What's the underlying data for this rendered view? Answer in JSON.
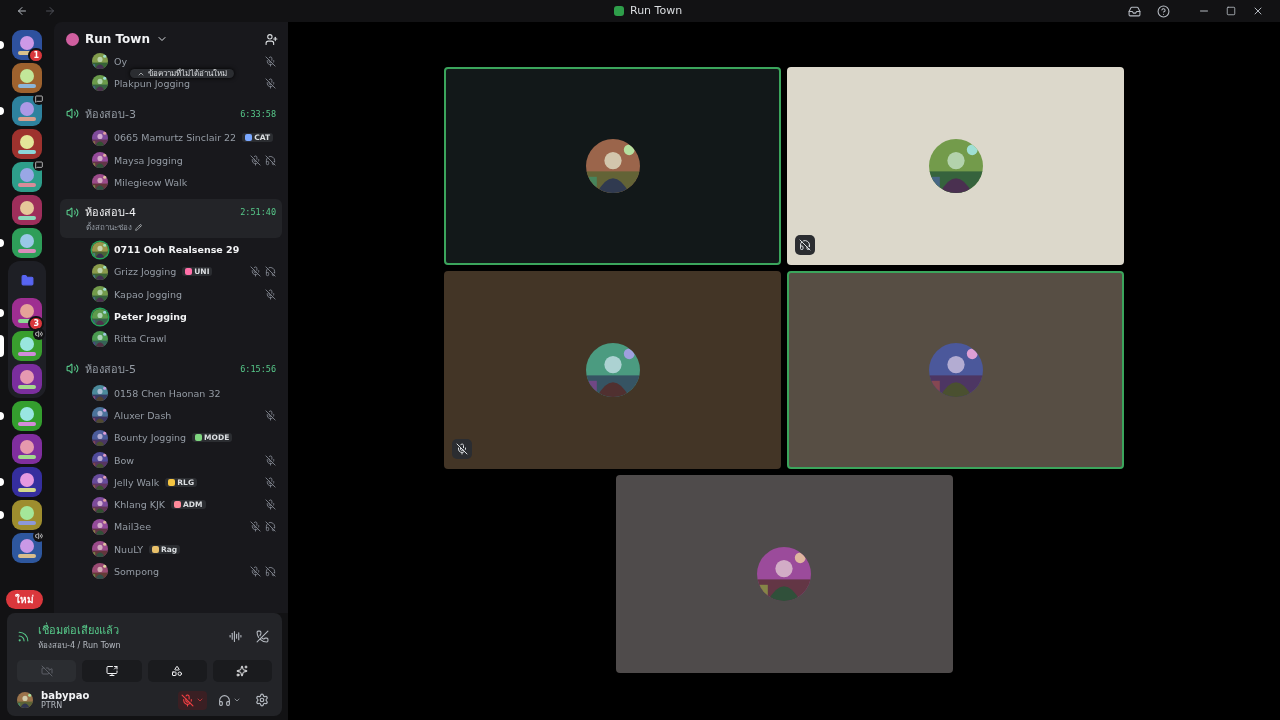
{
  "titlebar": {
    "title": "Run Town"
  },
  "servers": [
    {
      "kind": "server",
      "badge": "1",
      "unread": true,
      "selected": false,
      "chat_badge": false,
      "voice_badge": false
    },
    {
      "kind": "server",
      "unread": false,
      "selected": false,
      "chat_badge": false,
      "voice_badge": false
    },
    {
      "kind": "server",
      "unread": true,
      "selected": false,
      "chat_badge": true,
      "voice_badge": false
    },
    {
      "kind": "server",
      "unread": false,
      "selected": false,
      "chat_badge": false,
      "voice_badge": false
    },
    {
      "kind": "server",
      "unread": false,
      "selected": false,
      "chat_badge": true,
      "voice_badge": false
    },
    {
      "kind": "server",
      "unread": false,
      "selected": false,
      "chat_badge": false,
      "voice_badge": false
    },
    {
      "kind": "server",
      "unread": true,
      "selected": false,
      "chat_badge": false,
      "voice_badge": false
    },
    {
      "kind": "folder",
      "children": [
        {
          "kind": "server",
          "badge": "3",
          "unread": true,
          "selected": false,
          "chat_badge": false,
          "voice_badge": false
        },
        {
          "kind": "server",
          "unread": false,
          "selected": true,
          "chat_badge": false,
          "voice_badge": true
        },
        {
          "kind": "server",
          "unread": false,
          "selected": false,
          "chat_badge": false,
          "voice_badge": false
        }
      ]
    },
    {
      "kind": "server",
      "unread": true,
      "selected": false,
      "chat_badge": false,
      "voice_badge": false
    },
    {
      "kind": "server",
      "unread": false,
      "selected": false,
      "chat_badge": false,
      "voice_badge": false
    },
    {
      "kind": "server",
      "unread": true,
      "selected": false,
      "chat_badge": false,
      "voice_badge": false
    },
    {
      "kind": "server",
      "unread": true,
      "selected": false,
      "chat_badge": false,
      "voice_badge": false
    },
    {
      "kind": "server",
      "unread": false,
      "selected": false,
      "chat_badge": false,
      "voice_badge": true
    }
  ],
  "new_pill": "ใหม่",
  "sidebar": {
    "server_name": "Run Town",
    "unread_tooltip": "ข้อความที่ไม่ได้อ่านใหม่",
    "top_users": [
      {
        "name": "Oy",
        "speaking": false,
        "muted": true,
        "deafened": false
      },
      {
        "name": "Plakpun Jogging",
        "speaking": false,
        "muted": true,
        "deafened": false
      }
    ],
    "channels": [
      {
        "name": "ห้องสอบ-3",
        "timer": "6:33:58",
        "selected": false,
        "users": [
          {
            "name": "0665 Mamurtz Sinclair 22",
            "tag": {
              "label": "CAT",
              "color": "#7aa7ff"
            },
            "speaking": false,
            "muted": false,
            "deafened": false
          },
          {
            "name": "Maysa Jogging",
            "speaking": false,
            "muted": true,
            "deafened": true
          },
          {
            "name": "Milegieow Walk",
            "speaking": false,
            "muted": false,
            "deafened": false
          }
        ]
      },
      {
        "name": "ห้องสอบ-4",
        "timer": "2:51:40",
        "status": "ตั้งสถานะช่อง",
        "selected": true,
        "users": [
          {
            "name": "0711 Ooh Realsense 29",
            "speaking": true,
            "muted": false,
            "deafened": false
          },
          {
            "name": "Grizz Jogging",
            "tag": {
              "label": "UNI",
              "color": "#ff6fa8"
            },
            "speaking": false,
            "muted": true,
            "deafened": true
          },
          {
            "name": "Kapao Jogging",
            "speaking": false,
            "muted": true,
            "deafened": false
          },
          {
            "name": "Peter Jogging",
            "speaking": true,
            "muted": false,
            "deafened": false
          },
          {
            "name": "Ritta Crawl",
            "speaking": false,
            "muted": false,
            "deafened": false
          }
        ]
      },
      {
        "name": "ห้องสอบ-5",
        "timer": "6:15:56",
        "selected": false,
        "users": [
          {
            "name": "0158 Chen Haonan 32",
            "speaking": false,
            "muted": false,
            "deafened": false
          },
          {
            "name": "Aluxer Dash",
            "speaking": false,
            "muted": true,
            "deafened": false
          },
          {
            "name": "Bounty Jogging",
            "tag": {
              "label": "MODE",
              "color": "#7fd67f"
            },
            "speaking": false,
            "muted": false,
            "deafened": false
          },
          {
            "name": "Bow",
            "speaking": false,
            "muted": true,
            "deafened": false
          },
          {
            "name": "Jelly Walk",
            "tag": {
              "label": "RLG",
              "color": "#f5c542"
            },
            "speaking": false,
            "muted": true,
            "deafened": false
          },
          {
            "name": "Khlang KJK",
            "tag": {
              "label": "ADM",
              "color": "#ff8a9a"
            },
            "speaking": false,
            "muted": true,
            "deafened": false
          },
          {
            "name": "Mail3ee",
            "speaking": false,
            "muted": true,
            "deafened": true
          },
          {
            "name": "NuuLY",
            "tag": {
              "label": "Rag",
              "color": "#e8c06a"
            },
            "speaking": false,
            "muted": false,
            "deafened": false
          },
          {
            "name": "Sompong",
            "speaking": false,
            "muted": true,
            "deafened": true
          }
        ]
      }
    ]
  },
  "voice_panel": {
    "status": "เชื่อมต่อเสียงแล้ว",
    "location": "ห้องสอบ-4 / Run Town",
    "camera_disabled": true
  },
  "user": {
    "name": "babypao",
    "status": "PTRN",
    "mic_muted": true
  },
  "stage": [
    {
      "color": "#121819",
      "speaking": true,
      "muted": false,
      "deafened": false
    },
    {
      "color": "#dcd8cb",
      "speaking": false,
      "muted": false,
      "deafened": true
    },
    {
      "color": "#433526",
      "speaking": false,
      "muted": true,
      "deafened": false
    },
    {
      "color": "#574e44",
      "speaking": true,
      "muted": false,
      "deafened": false
    },
    {
      "color": "#4f4b4b",
      "speaking": false,
      "muted": false,
      "deafened": false
    }
  ]
}
